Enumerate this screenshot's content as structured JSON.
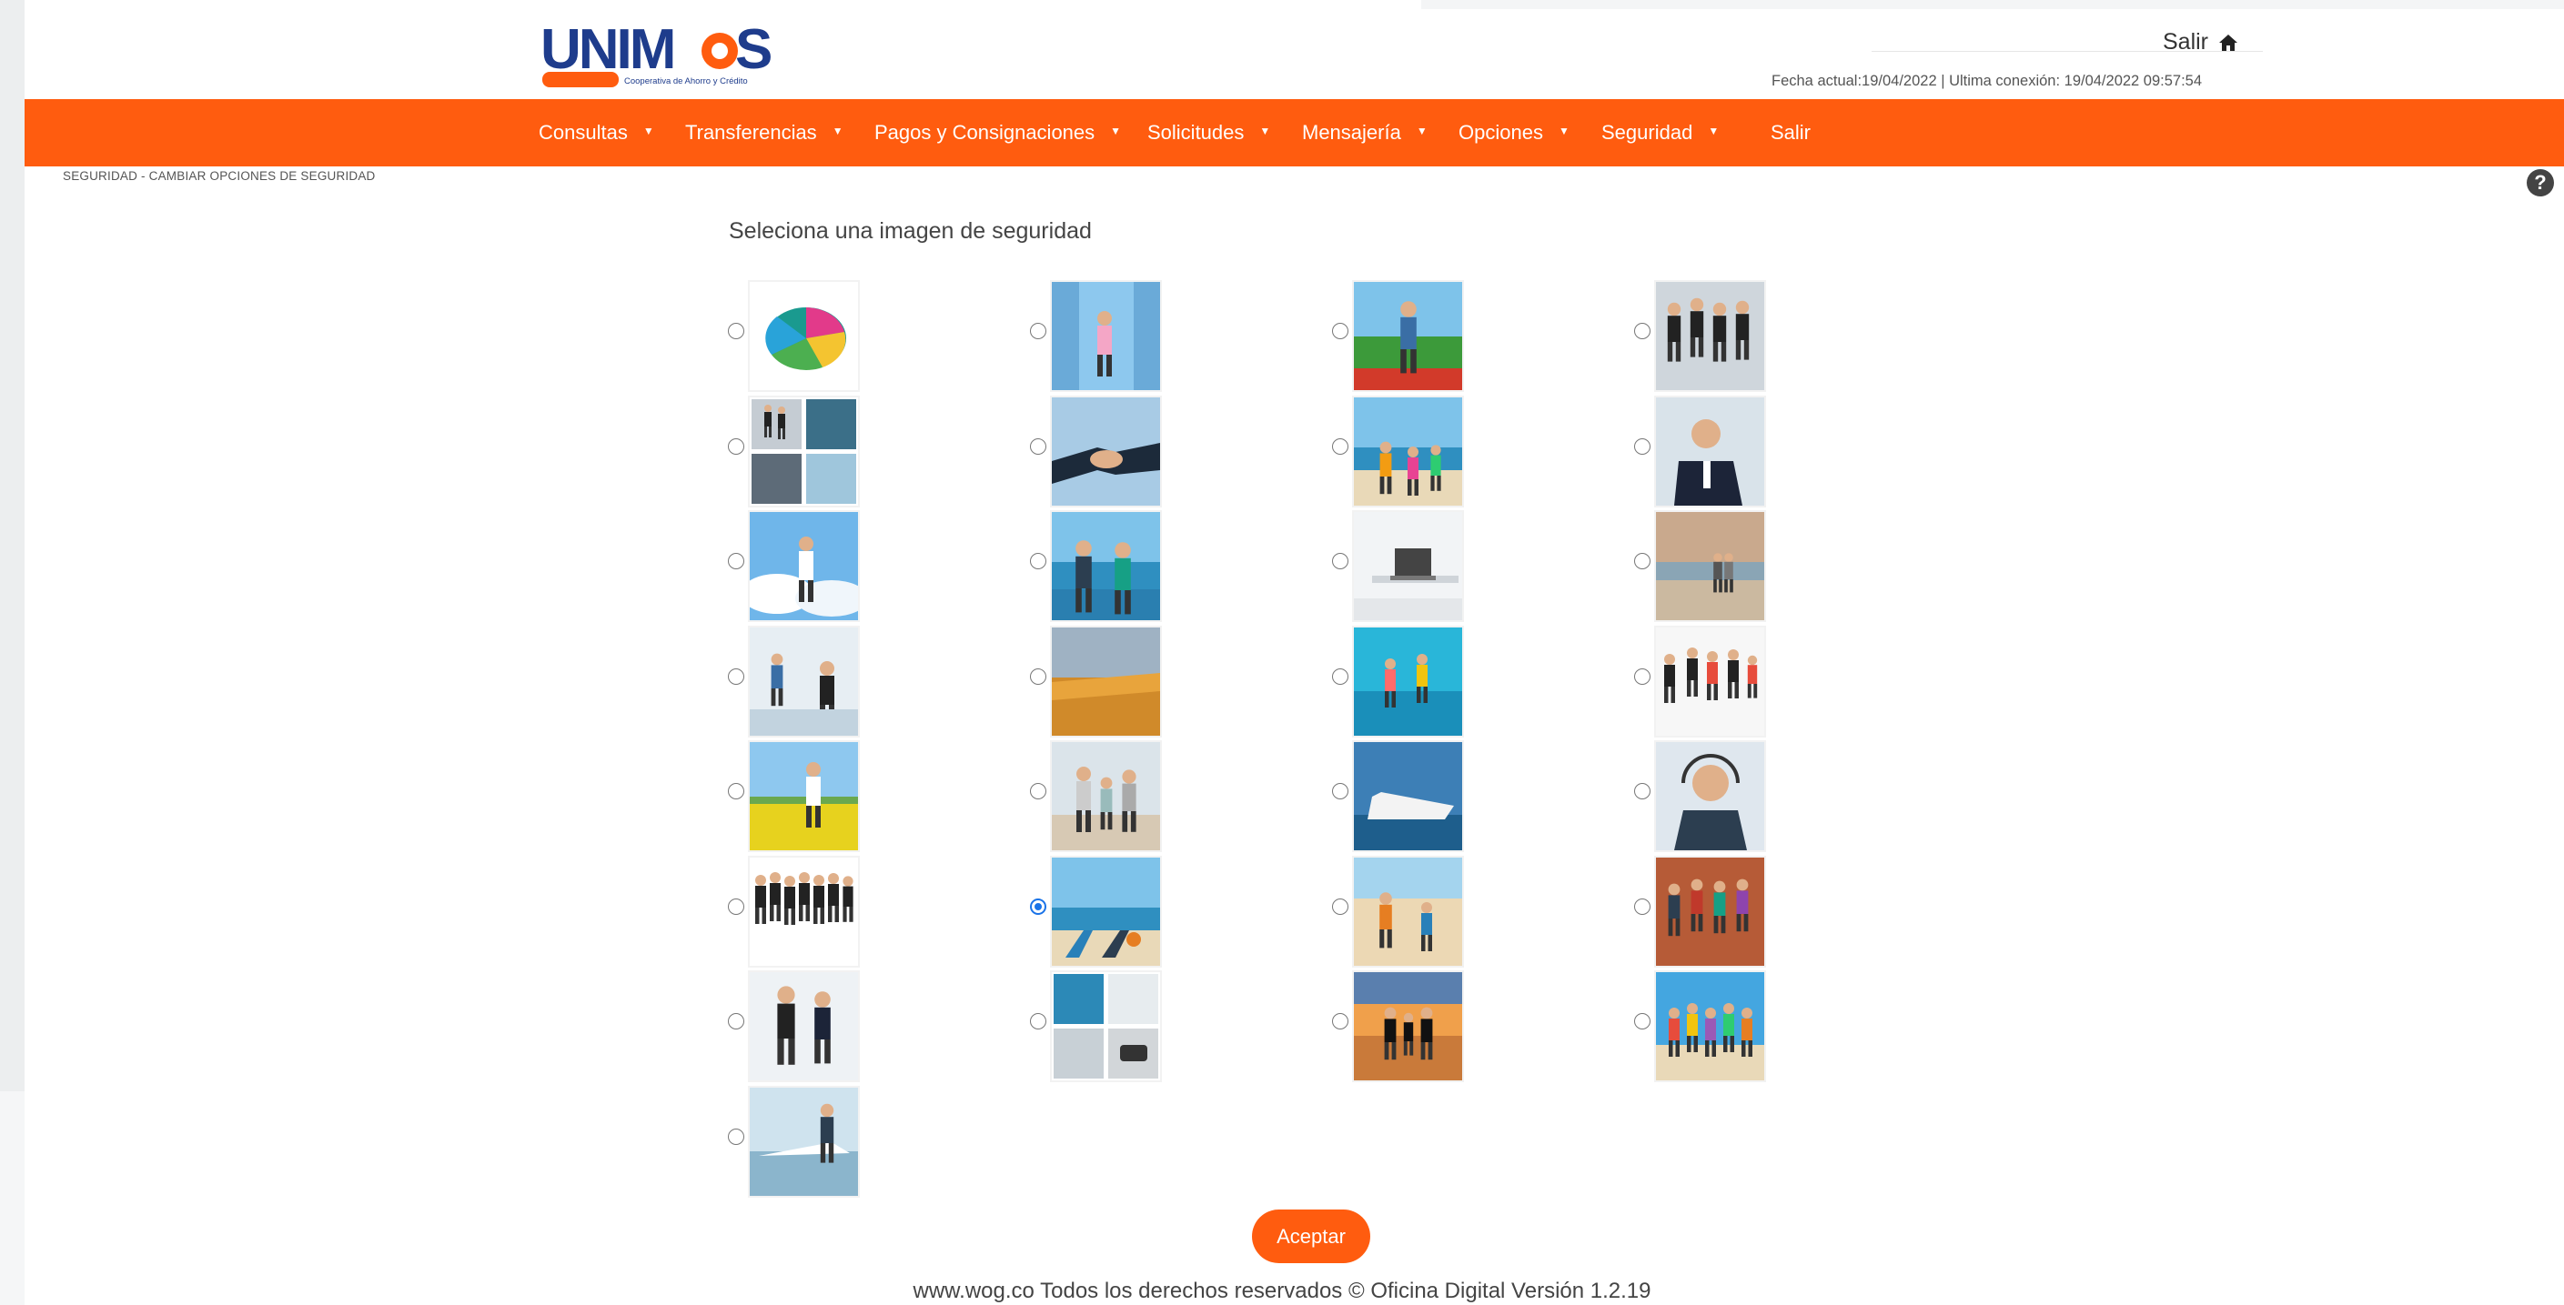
{
  "header": {
    "logo_text": "UNIMOS",
    "logo_tagline": "Cooperativa de Ahorro y Crédito",
    "salir_label": "Salir",
    "session_info": "Fecha actual:19/04/2022 | Ultima conexión: 19/04/2022 09:57:54",
    "home_icon": "home-icon"
  },
  "nav": {
    "items": [
      {
        "label": "Consultas",
        "caret": "▼"
      },
      {
        "label": "Transferencias",
        "caret": "▼"
      },
      {
        "label": "Pagos y Consignaciones",
        "caret": "▼"
      },
      {
        "label": "Solicitudes",
        "caret": "▼"
      },
      {
        "label": "Mensajería",
        "caret": "▼"
      },
      {
        "label": "Opciones",
        "caret": "▼"
      },
      {
        "label": "Seguridad",
        "caret": "▼"
      },
      {
        "label": "Salir"
      }
    ]
  },
  "breadcrumb": "SEGURIDAD - CAMBIAR OPCIONES DE SEGURIDAD",
  "help_label": "?",
  "main": {
    "title": "Seleciona una imagen de seguridad",
    "selected_index": 21,
    "images": [
      {
        "name": "pie-chart-image",
        "icon": "pie-chart"
      },
      {
        "name": "girl-jumping-image",
        "icon": "girl-jumping"
      },
      {
        "name": "father-child-field-image",
        "icon": "father-child"
      },
      {
        "name": "business-team-celebrating-image",
        "icon": "team-celebrating"
      },
      {
        "name": "business-collage-image",
        "icon": "collage"
      },
      {
        "name": "handshake-image",
        "icon": "handshake"
      },
      {
        "name": "family-beach-image",
        "icon": "family-beach"
      },
      {
        "name": "businessman-portrait-image",
        "icon": "businessman"
      },
      {
        "name": "man-sky-arms-up-image",
        "icon": "man-sky"
      },
      {
        "name": "couple-sea-image",
        "icon": "couple-sea"
      },
      {
        "name": "office-desk-laptop-image",
        "icon": "desk-laptop"
      },
      {
        "name": "couple-beach-sunset-image",
        "icon": "beach-couple"
      },
      {
        "name": "business-meeting-image",
        "icon": "meeting"
      },
      {
        "name": "wheat-field-image",
        "icon": "wheat"
      },
      {
        "name": "people-jumping-sea-image",
        "icon": "jumping-sea"
      },
      {
        "name": "business-people-jumping-image",
        "icon": "people-jumping"
      },
      {
        "name": "woman-yellow-field-image",
        "icon": "yellow-field"
      },
      {
        "name": "family-walking-beach-image",
        "icon": "family-walking"
      },
      {
        "name": "cruise-ship-image",
        "icon": "cruise-ship"
      },
      {
        "name": "woman-headset-image",
        "icon": "headset"
      },
      {
        "name": "business-group-standing-image",
        "icon": "group-standing"
      },
      {
        "name": "beach-chairs-image",
        "icon": "beach-chairs"
      },
      {
        "name": "kids-sand-castle-image",
        "icon": "kids-sand"
      },
      {
        "name": "group-thumbs-up-image",
        "icon": "thumbs-up"
      },
      {
        "name": "business-couple-image",
        "icon": "business-couple"
      },
      {
        "name": "finance-tools-collage-image",
        "icon": "finance-collage"
      },
      {
        "name": "family-sunset-pier-image",
        "icon": "sunset-family"
      },
      {
        "name": "colorful-beach-group-image",
        "icon": "colorful-group"
      },
      {
        "name": "woman-yacht-image",
        "icon": "yacht"
      }
    ]
  },
  "actions": {
    "accept_label": "Aceptar"
  },
  "footer": {
    "text": "www.wog.co Todos los derechos reservados © Oficina Digital Versión 1.2.19"
  },
  "colors": {
    "brand_orange": "#ff5c0f",
    "logo_blue": "#1e3c8c",
    "radio_selected": "#1a73e8"
  }
}
